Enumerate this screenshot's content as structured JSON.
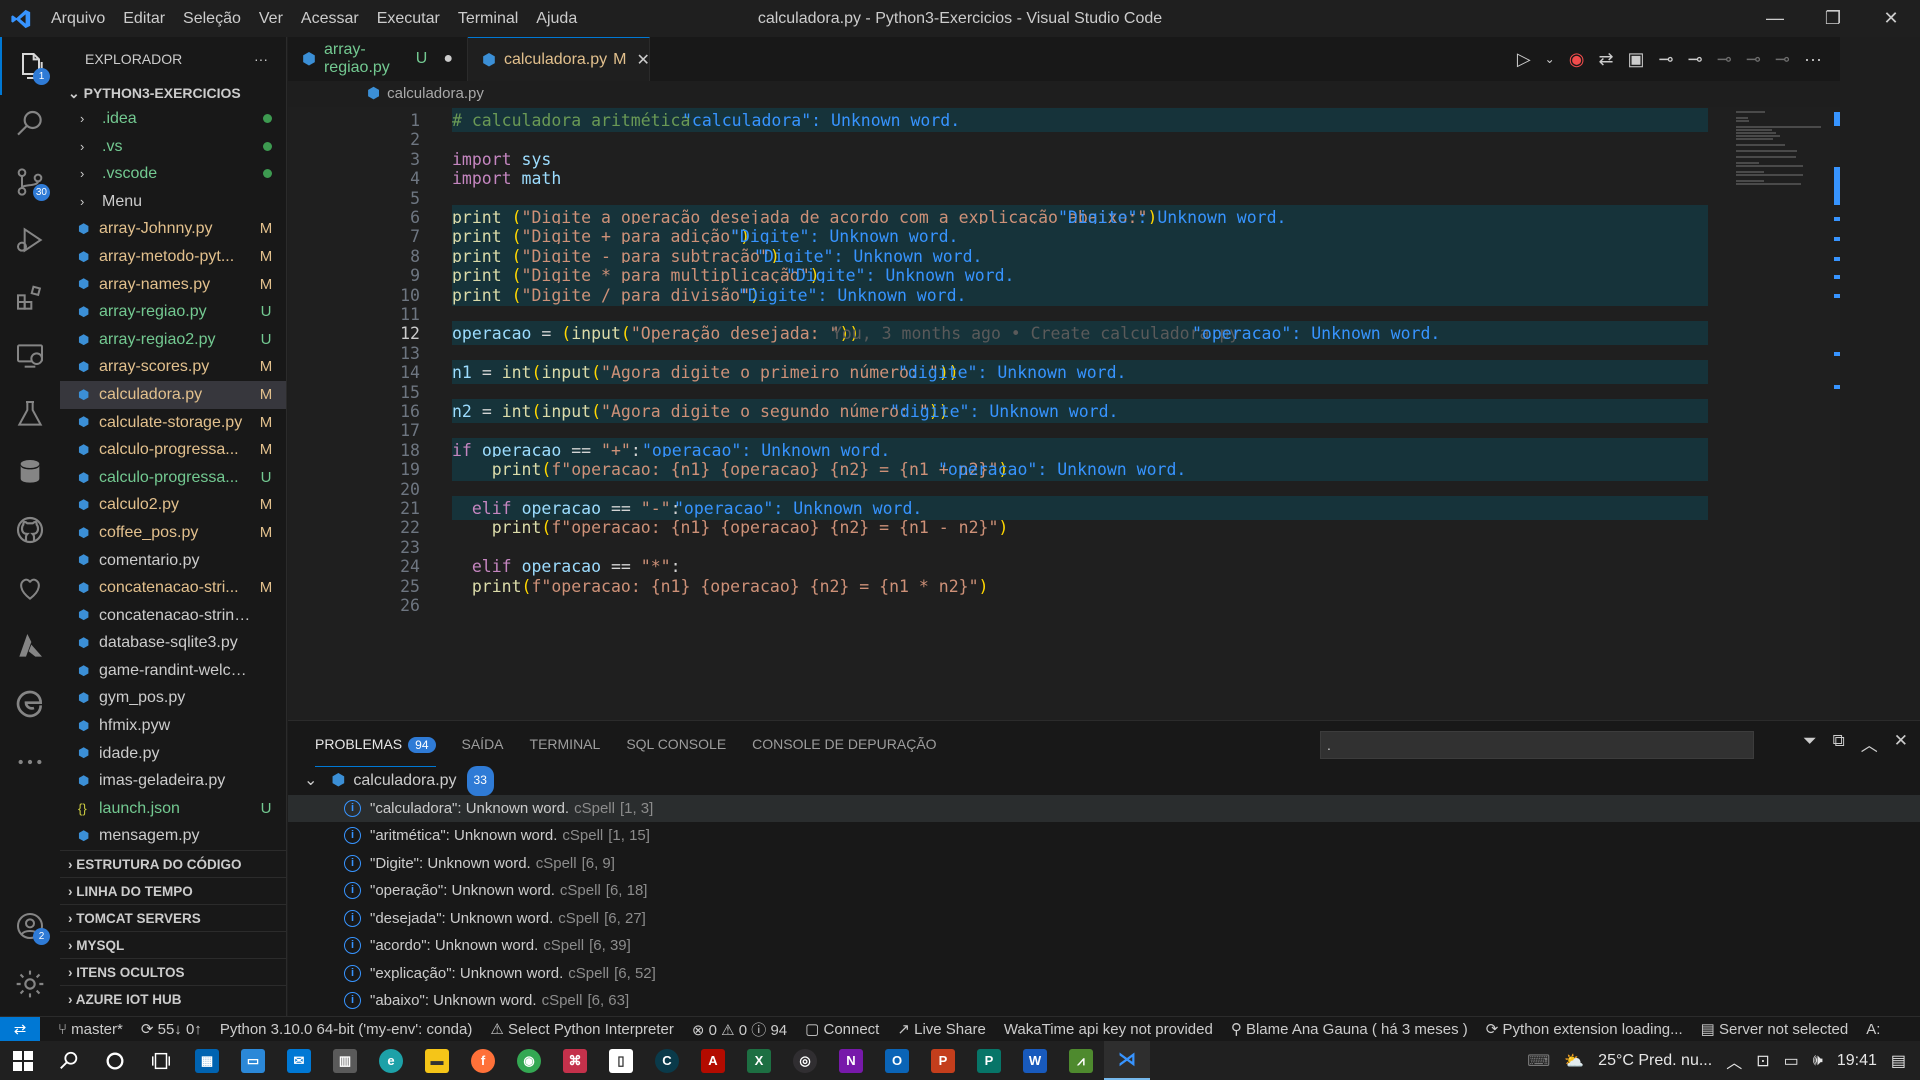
{
  "titlebar": {
    "menu": [
      "Arquivo",
      "Editar",
      "Seleção",
      "Ver",
      "Acessar",
      "Executar",
      "Terminal",
      "Ajuda"
    ],
    "title": "calculadora.py - Python3-Exercicios - Visual Studio Code"
  },
  "activity": {
    "explorer_badge": "1",
    "scm_badge": "30",
    "accounts_badge": "2"
  },
  "explorer": {
    "header": "EXPLORADOR",
    "root": "PYTHON3-EXERCICIOS",
    "folders": [
      ".idea",
      ".vs",
      ".vscode",
      "Menu"
    ],
    "files": [
      {
        "name": "array-Johnny.py",
        "status": "M"
      },
      {
        "name": "array-metodo-pyt...",
        "status": "M"
      },
      {
        "name": "array-names.py",
        "status": "M"
      },
      {
        "name": "array-regiao.py",
        "status": "U"
      },
      {
        "name": "array-regiao2.py",
        "status": "U"
      },
      {
        "name": "array-scores.py",
        "status": "M"
      },
      {
        "name": "calculadora.py",
        "status": "M"
      },
      {
        "name": "calculate-storage.py",
        "status": "M"
      },
      {
        "name": "calculo-progressa...",
        "status": "M"
      },
      {
        "name": "calculo-progressa...",
        "status": "U"
      },
      {
        "name": "calculo2.py",
        "status": "M"
      },
      {
        "name": "coffee_pos.py",
        "status": "M"
      },
      {
        "name": "comentario.py",
        "status": ""
      },
      {
        "name": "concatenacao-stri...",
        "status": "M"
      },
      {
        "name": "concatenacao-string.py",
        "status": ""
      },
      {
        "name": "database-sqlite3.py",
        "status": ""
      },
      {
        "name": "game-randint-welcome...",
        "status": ""
      },
      {
        "name": "gym_pos.py",
        "status": ""
      },
      {
        "name": "hfmix.pyw",
        "status": ""
      },
      {
        "name": "idade.py",
        "status": ""
      },
      {
        "name": "imas-geladeira.py",
        "status": ""
      },
      {
        "name": "launch.json",
        "status": "U"
      },
      {
        "name": "mensagem.py",
        "status": ""
      }
    ],
    "sections": [
      "ESTRUTURA DO CÓDIGO",
      "LINHA DO TEMPO",
      "TOMCAT SERVERS",
      "MYSQL",
      "ITENS OCULTOS",
      "AZURE IOT HUB"
    ]
  },
  "tabs": [
    {
      "name": "array-regiao.py",
      "status": "U",
      "active": false
    },
    {
      "name": "calculadora.py",
      "status": "M",
      "active": true
    }
  ],
  "breadcrumb": "calculadora.py",
  "editor": {
    "current_line": 12,
    "blame": "You, 3 months ago • Create calculadora.py",
    "diagnostics": {
      "1": "\"calculadora\": Unknown word.",
      "6": "\"Digite\": Unknown word.",
      "7": "\"Digite\": Unknown word.",
      "8": "\"Digite\": Unknown word.",
      "9": "\"Digite\": Unknown word.",
      "10": "\"Digite\": Unknown word.",
      "12": "\"operacao\": Unknown word.",
      "14": "\"digite\": Unknown word.",
      "16": "\"digite\": Unknown word.",
      "18": "\"operacao\": Unknown word.",
      "19": "\"operacao\": Unknown word.",
      "21": "\"operacao\": Unknown word."
    },
    "lines": [
      "# calculadora aritmética",
      "",
      "import sys",
      "import math",
      "",
      "print (\"Digite a operação desejada de acordo com a explicação abaixo:\")",
      "print (\"Digite + para adição\")",
      "print (\"Digite - para subtração\")",
      "print (\"Digite * para multiplicação\")",
      "print (\"Digite / para divisão\")",
      "",
      "operacao = (input(\"Operação desejada: \"))",
      "",
      "n1 = int(input(\"Agora digite o primeiro número: \"))",
      "",
      "n2 = int(input(\"Agora digite o segundo número: \"))",
      "",
      "if operacao == \"+\":",
      "    print(f\"operacao: {n1} {operacao} {n2} = {n1 + n2}\")",
      "",
      "  elif operacao == \"-\":",
      "    print(f\"operacao: {n1} {operacao} {n2} = {n1 - n2}\")",
      "",
      "  elif operacao == \"*\":",
      "  print(f\"operacao: {n1} {operacao} {n2} = {n1 * n2}\")",
      ""
    ]
  },
  "panel": {
    "tabs": [
      "PROBLEMAS",
      "SAÍDA",
      "TERMINAL",
      "SQL CONSOLE",
      "CONSOLE DE DEPURAÇÃO"
    ],
    "problems_count": "94",
    "filter_value": ".",
    "group_file": "calculadora.py",
    "group_count": "33",
    "problems": [
      {
        "msg": "\"calculadora\": Unknown word.",
        "src": "cSpell",
        "pos": "[1, 3]"
      },
      {
        "msg": "\"aritmética\": Unknown word.",
        "src": "cSpell",
        "pos": "[1, 15]"
      },
      {
        "msg": "\"Digite\": Unknown word.",
        "src": "cSpell",
        "pos": "[6, 9]"
      },
      {
        "msg": "\"operação\": Unknown word.",
        "src": "cSpell",
        "pos": "[6, 18]"
      },
      {
        "msg": "\"desejada\": Unknown word.",
        "src": "cSpell",
        "pos": "[6, 27]"
      },
      {
        "msg": "\"acordo\": Unknown word.",
        "src": "cSpell",
        "pos": "[6, 39]"
      },
      {
        "msg": "\"explicação\": Unknown word.",
        "src": "cSpell",
        "pos": "[6, 52]"
      },
      {
        "msg": "\"abaixo\": Unknown word.",
        "src": "cSpell",
        "pos": "[6, 63]"
      }
    ]
  },
  "statusbar": {
    "branch": "master*",
    "sync": "55↓ 0↑",
    "interpreter": "Python 3.10.0 64-bit ('my-env': conda)",
    "select_interpreter": "Select Python Interpreter",
    "problems": "⊗ 0 ⚠ 0 ⓘ 94",
    "connect": "Connect",
    "liveshare": "Live Share",
    "wakatime": "WakaTime api key not provided",
    "blame": "Blame Ana Gauna ( há 3 meses )",
    "python_ext": "Python extension loading...",
    "server": "Server not selected",
    "extra": "A:"
  },
  "taskbar": {
    "weather": "25°C  Pred. nu...",
    "time": "19:41"
  }
}
